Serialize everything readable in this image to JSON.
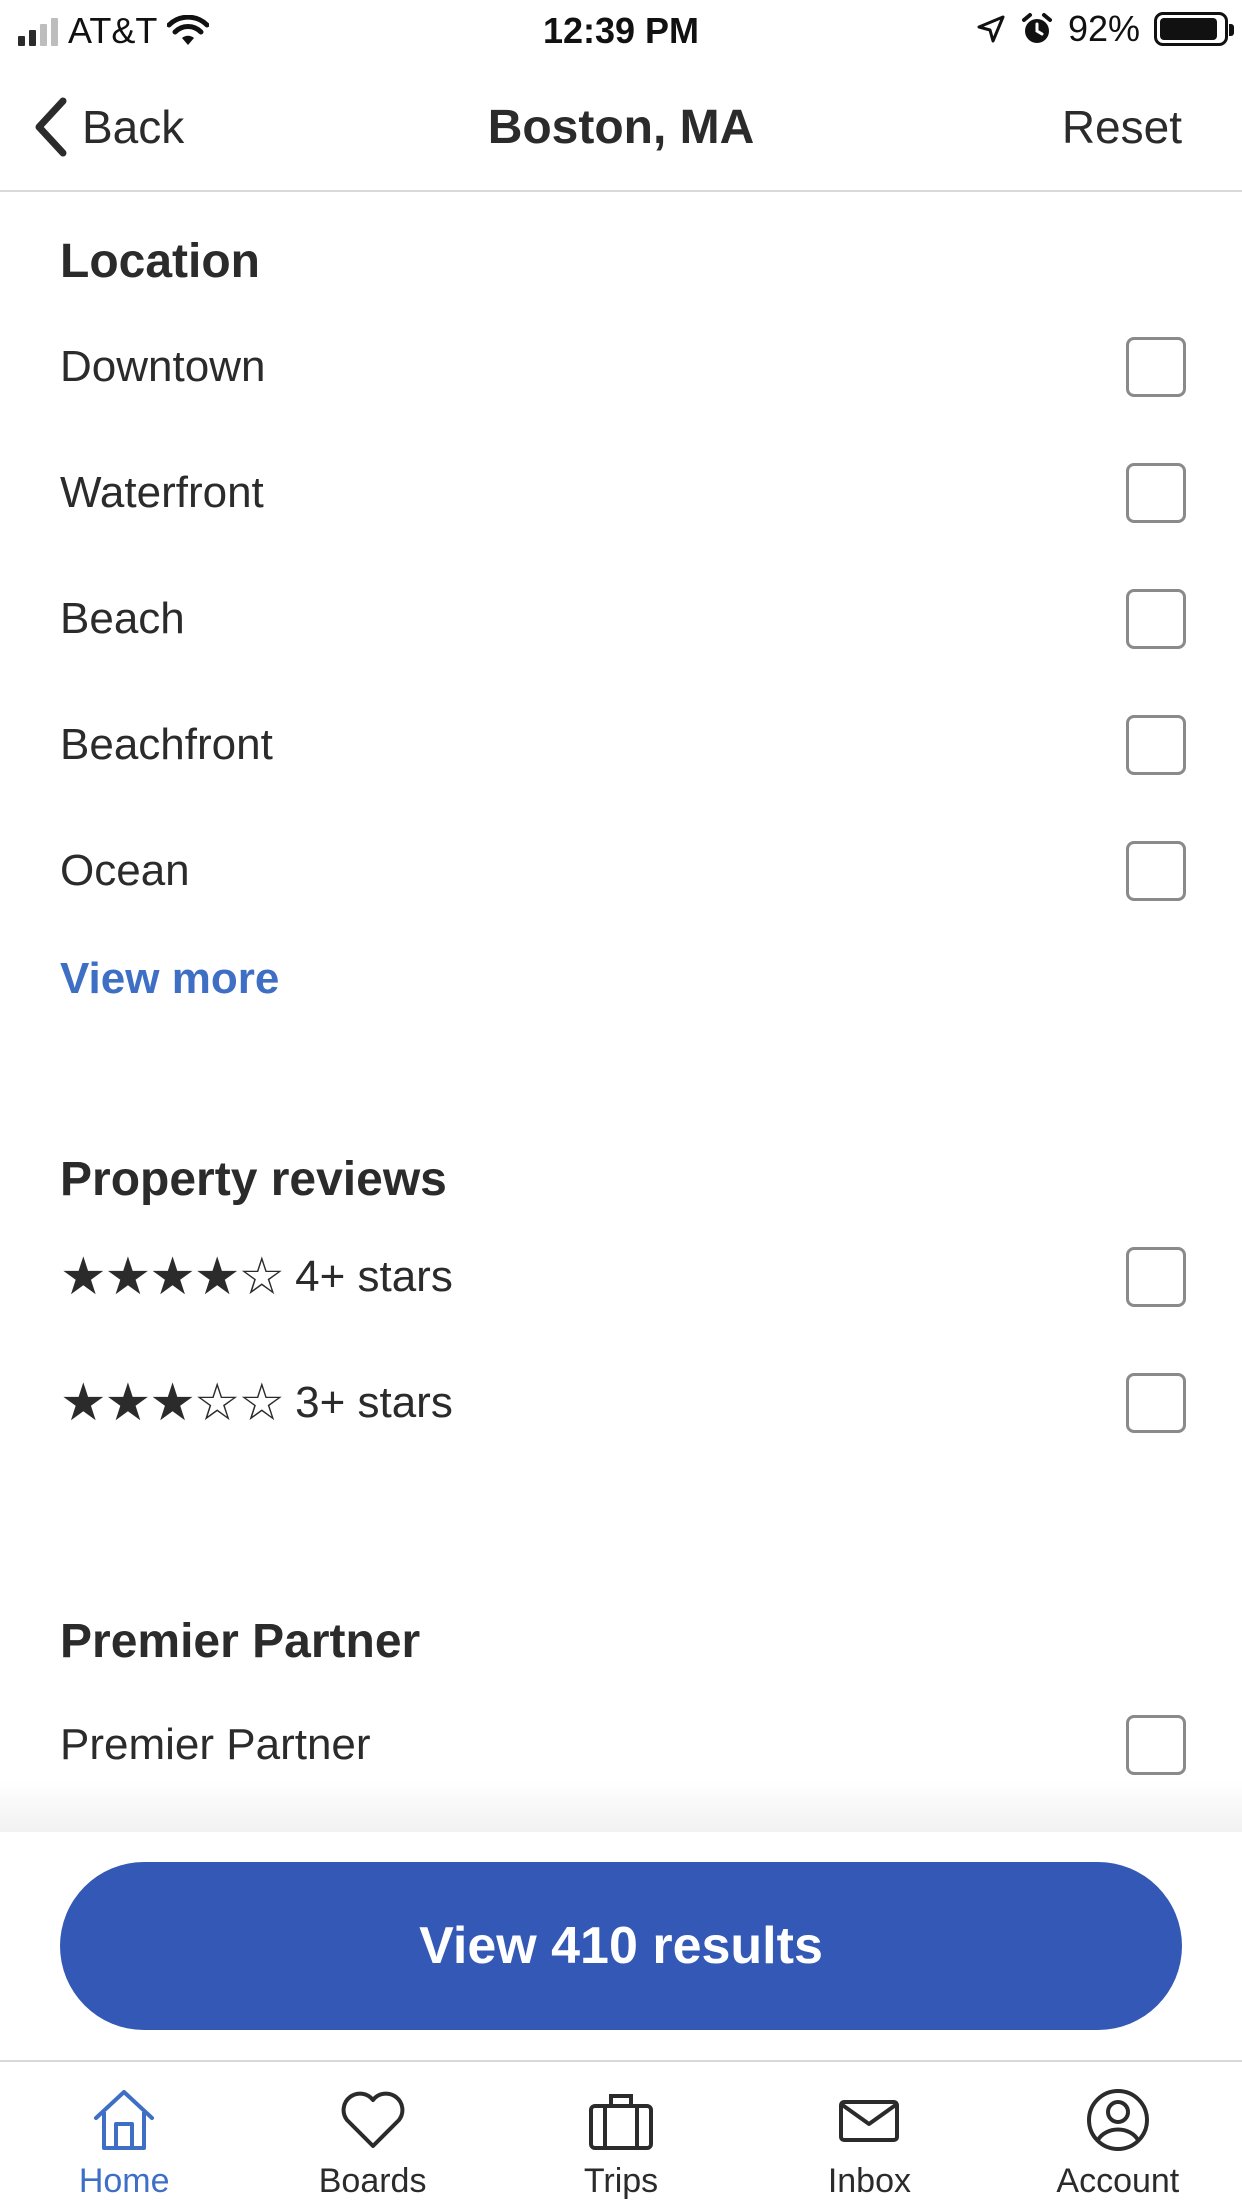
{
  "status_bar": {
    "carrier": "AT&T",
    "time": "12:39 PM",
    "battery": "92%"
  },
  "nav": {
    "back_label": "Back",
    "title": "Boston, MA",
    "reset_label": "Reset"
  },
  "location": {
    "title": "Location",
    "items": [
      {
        "label": "Downtown",
        "checked": false
      },
      {
        "label": "Waterfront",
        "checked": false
      },
      {
        "label": "Beach",
        "checked": false
      },
      {
        "label": "Beachfront",
        "checked": false
      },
      {
        "label": "Ocean",
        "checked": false
      }
    ],
    "view_more": "View more"
  },
  "reviews": {
    "title": "Property reviews",
    "items": [
      {
        "stars": "★★★★☆",
        "label": "4+ stars",
        "rating": 4,
        "checked": false
      },
      {
        "stars": "★★★☆☆",
        "label": "3+ stars",
        "rating": 3,
        "checked": false
      }
    ]
  },
  "premier": {
    "title": "Premier Partner",
    "items": [
      {
        "label": "Premier Partner",
        "checked": false
      }
    ]
  },
  "cta": {
    "label": "View 410 results"
  },
  "tabs": [
    {
      "label": "Home",
      "icon": "home-icon",
      "active": true
    },
    {
      "label": "Boards",
      "icon": "heart-icon",
      "active": false
    },
    {
      "label": "Trips",
      "icon": "suitcase-icon",
      "active": false
    },
    {
      "label": "Inbox",
      "icon": "envelope-icon",
      "active": false
    },
    {
      "label": "Account",
      "icon": "account-icon",
      "active": false
    }
  ],
  "colors": {
    "accent": "#3358b5",
    "link": "#3f6fc5",
    "text": "#2b2b2b"
  }
}
